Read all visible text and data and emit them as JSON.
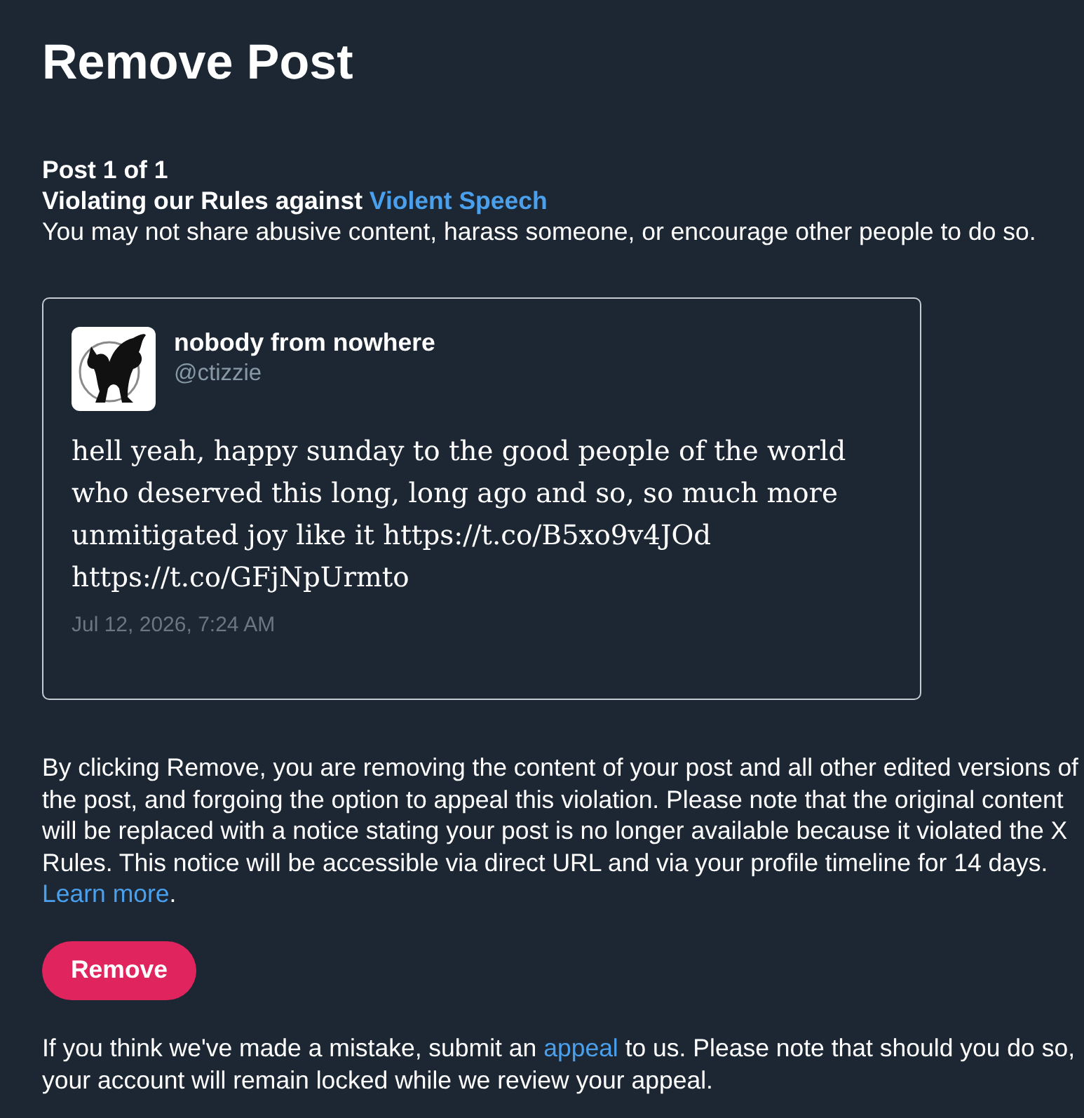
{
  "page": {
    "title": "Remove Post"
  },
  "violation": {
    "counter": "Post 1 of 1",
    "heading": "Violating our Rules against ",
    "rule_link": "Violent Speech",
    "description": "You may not share abusive content, harass someone, or encourage other people to do so."
  },
  "post": {
    "author_name": "nobody from nowhere",
    "handle": "@ctizzie",
    "text": "hell yeah, happy sunday to the good people of the world who deserved this long, long ago and so, so much more unmitigated joy like it https://t.co/B5xo9v4JOd https://t.co/GFjNpUrmto",
    "timestamp": "Jul 12, 2026, 7:24 AM"
  },
  "notice": {
    "text": "By clicking Remove, you are removing the content of your post and all other edited versions of the post, and forgoing the option to appeal this violation. Please note that the original content will be replaced with a notice stating your post is no longer available because it violated the X Rules. This notice will be accessible via direct URL and via your profile timeline for 14 days. ",
    "link": "Learn more",
    "after": "."
  },
  "remove_button": {
    "label": "Remove"
  },
  "appeal_note": {
    "before": "If you think we've made a mistake, submit an ",
    "link": "appeal",
    "after": " to us. Please note that should you do so, your account will remain locked while we review your appeal."
  }
}
